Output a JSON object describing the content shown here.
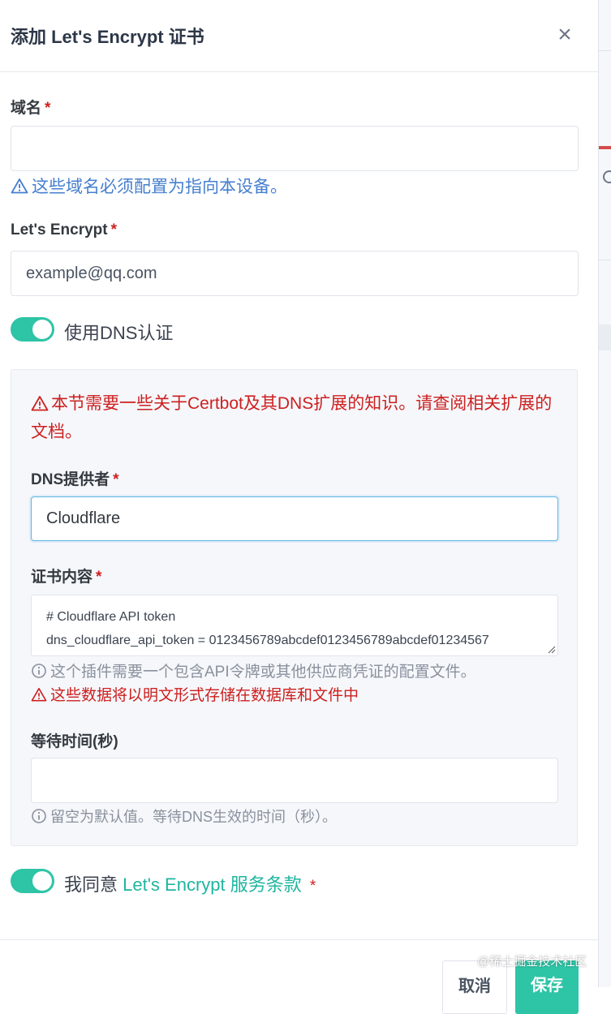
{
  "modal": {
    "title": "添加 Let's Encrypt 证书",
    "close_symbol": "×"
  },
  "domain": {
    "label": "域名",
    "required_mark": "*",
    "value": "",
    "hint": "这些域名必须配置为指向本设备。"
  },
  "email": {
    "label": "Let's Encrypt",
    "required_mark": "*",
    "value": "example@qq.com"
  },
  "dns_toggle": {
    "label": "使用DNS认证",
    "checked": true
  },
  "dns_section": {
    "warning": "本节需要一些关于Certbot及其DNS扩展的知识。请查阅相关扩展的文档。",
    "provider": {
      "label": "DNS提供者",
      "required_mark": "*",
      "value": "Cloudflare"
    },
    "credentials": {
      "label": "证书内容",
      "required_mark": "*",
      "lines": [
        "# Cloudflare API token",
        "dns_cloudflare_api_token = 0123456789abcdef0123456789abcdef01234567"
      ],
      "info_hint": "这个插件需要一个包含API令牌或其他供应商凭证的配置文件。",
      "warning_hint": "这些数据将以明文形式存储在数据库和文件中"
    },
    "propagation": {
      "label": "等待时间(秒)",
      "value": "",
      "hint": "留空为默认值。等待DNS生效的时间（秒）。"
    }
  },
  "agree_toggle": {
    "prefix": "我同意",
    "link_text": "Let's Encrypt 服务条款",
    "required_mark": "*",
    "checked": true
  },
  "footer": {
    "cancel_label": "取消",
    "save_label": "保存",
    "watermark": "@稀土掘金技术社区"
  },
  "colors": {
    "accent": "#2ec4a6",
    "link": "#1fb5a0",
    "danger": "#cd201f",
    "info": "#467fcf"
  }
}
